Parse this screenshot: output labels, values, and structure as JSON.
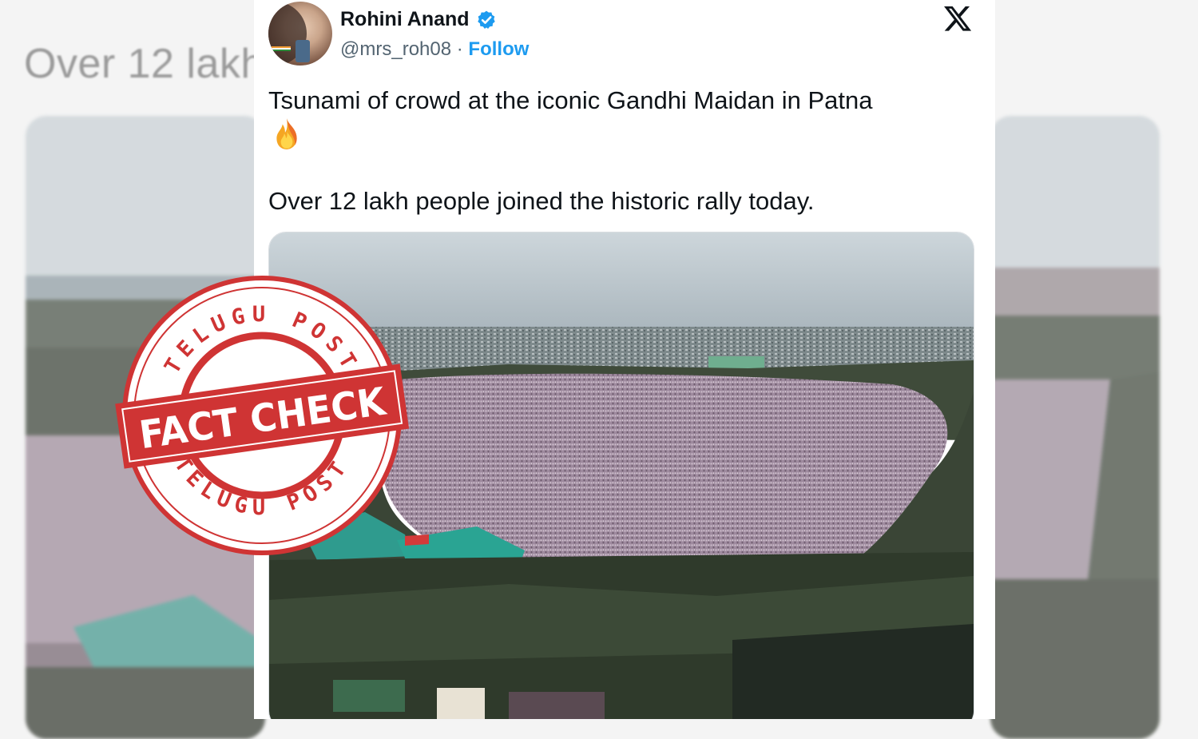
{
  "background": {
    "headline": "Over 12 lakh"
  },
  "tweet": {
    "author_name": "Rohini Anand",
    "handle": "@mrs_roh08",
    "separator": " · ",
    "follow_label": "Follow",
    "text_line1": "Tsunami of crowd at the iconic Gandhi Maidan in Patna",
    "text_line2": "Over 12 lakh people joined the historic rally today.",
    "verified_color": "#1d9bf0",
    "platform_icon": "x-logo-icon",
    "emoji_icon": "fire-emoji-icon"
  },
  "stamp": {
    "top_text": "TELUGU POST",
    "bottom_text": "TELUGU POST",
    "banner_text": "FACT CHECK",
    "color": "#cf3434"
  }
}
